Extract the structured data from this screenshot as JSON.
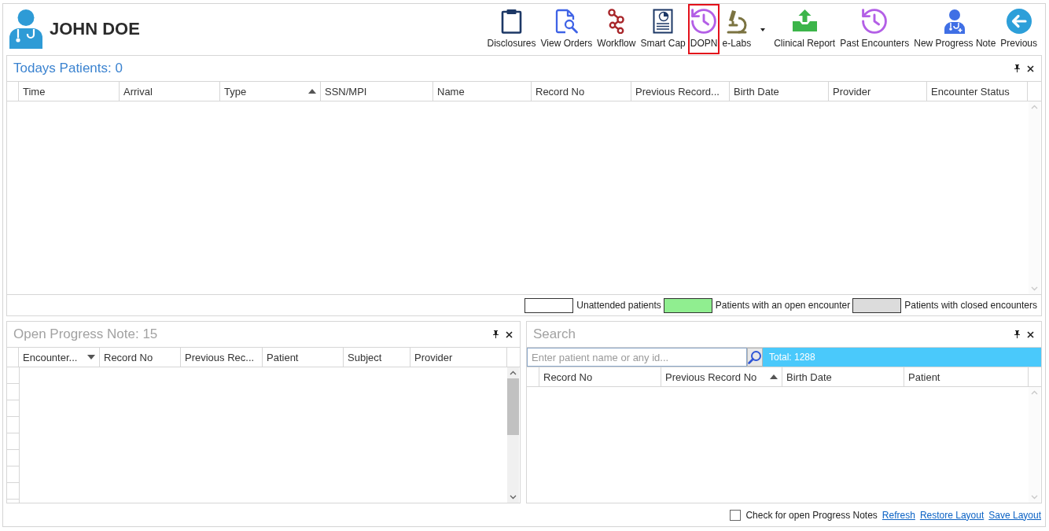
{
  "user": {
    "name": "JOHN DOE"
  },
  "toolbar": [
    {
      "kind": "clipboard",
      "label": "Disclosures",
      "selected": false,
      "dropdown": false
    },
    {
      "kind": "document-search",
      "label": "View Orders",
      "selected": false,
      "dropdown": false
    },
    {
      "kind": "nodes",
      "label": "Workflow",
      "selected": false,
      "dropdown": false
    },
    {
      "kind": "document-chart",
      "label": "Smart Cap",
      "selected": false,
      "dropdown": false
    },
    {
      "kind": "history",
      "label": "DOPN",
      "selected": true,
      "dropdown": false
    },
    {
      "kind": "microscope",
      "label": "e-Labs",
      "selected": false,
      "dropdown": true
    },
    {
      "kind": "upload-tray",
      "label": "Clinical Report",
      "selected": false,
      "dropdown": false
    },
    {
      "kind": "history",
      "label": "Past Encounters",
      "selected": false,
      "dropdown": false
    },
    {
      "kind": "doctor",
      "label": "New Progress Note",
      "selected": false,
      "dropdown": false
    },
    {
      "kind": "back",
      "label": "Previous",
      "selected": false,
      "dropdown": false
    }
  ],
  "todays_patients": {
    "title": "Todays Patients: 0",
    "active": true,
    "columns": [
      {
        "label": "Time",
        "sorted_ascending": false,
        "sorted_descending": false
      },
      {
        "label": "Arrival",
        "sorted_ascending": false,
        "sorted_descending": false
      },
      {
        "label": "Type",
        "sorted_ascending": true,
        "sorted_descending": false
      },
      {
        "label": "SSN/MPI",
        "sorted_ascending": false,
        "sorted_descending": false
      },
      {
        "label": "Name",
        "sorted_ascending": false,
        "sorted_descending": false
      },
      {
        "label": "Record No",
        "sorted_ascending": false,
        "sorted_descending": false
      },
      {
        "label": "Previous Record...",
        "sorted_ascending": false,
        "sorted_descending": false
      },
      {
        "label": "Birth Date",
        "sorted_ascending": false,
        "sorted_descending": false
      },
      {
        "label": "Provider",
        "sorted_ascending": false,
        "sorted_descending": false
      },
      {
        "label": "Encounter Status",
        "sorted_ascending": false,
        "sorted_descending": false
      }
    ],
    "legend": [
      {
        "label": "Unattended patients",
        "color": "#ffffff"
      },
      {
        "label": "Patients with an open encounter",
        "color": "#90ee90"
      },
      {
        "label": "Patients with closed encounters",
        "color": "#dcdcdc"
      }
    ]
  },
  "open_progress_notes": {
    "title": "Open Progress Note: 15",
    "active": false,
    "columns": [
      {
        "label": "Encounter...",
        "sorted_ascending": false,
        "sorted_descending": true
      },
      {
        "label": "Record No",
        "sorted_ascending": false,
        "sorted_descending": false
      },
      {
        "label": "Previous Rec...",
        "sorted_ascending": false,
        "sorted_descending": false
      },
      {
        "label": "Patient",
        "sorted_ascending": false,
        "sorted_descending": false
      },
      {
        "label": "Subject",
        "sorted_ascending": false,
        "sorted_descending": false
      },
      {
        "label": "Provider",
        "sorted_ascending": false,
        "sorted_descending": false
      }
    ]
  },
  "search": {
    "title": "Search",
    "active": false,
    "field": {
      "placeholder": "Enter patient name or any id..."
    },
    "total": "Total: 1288",
    "columns": [
      {
        "label": "Record No",
        "sorted_ascending": false,
        "sorted_descending": false
      },
      {
        "label": "Previous Record No",
        "sorted_ascending": true,
        "sorted_descending": false
      },
      {
        "label": "Birth Date",
        "sorted_ascending": false,
        "sorted_descending": false
      },
      {
        "label": "Patient",
        "sorted_ascending": false,
        "sorted_descending": false
      }
    ]
  },
  "footer": {
    "check": {
      "label": "Check for open Progress Notes",
      "checked": false
    },
    "links": [
      "Refresh",
      "Restore Layout",
      "Save Layout"
    ]
  }
}
